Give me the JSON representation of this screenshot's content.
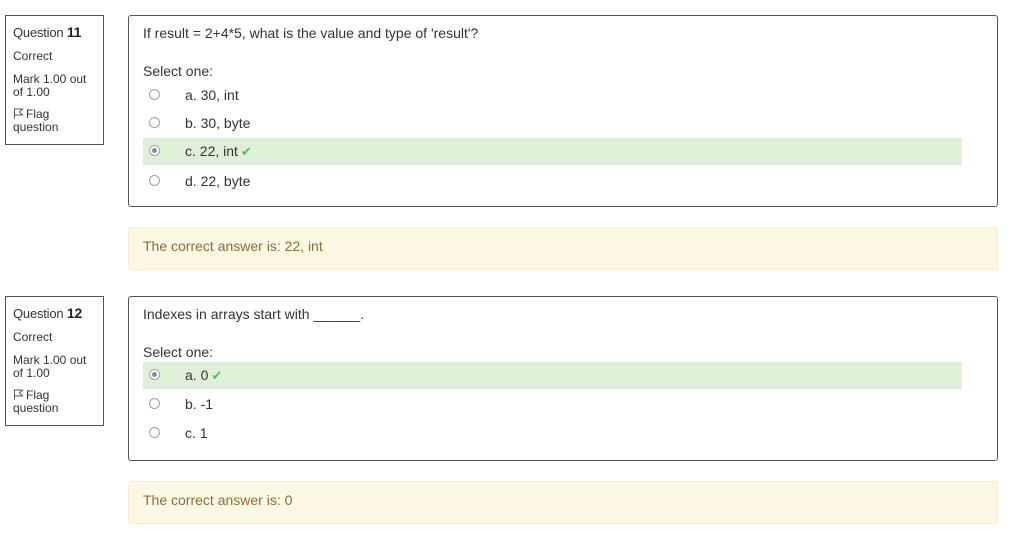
{
  "questions": [
    {
      "info": {
        "question_prefix": "Question",
        "number": "11",
        "state": "Correct",
        "mark": "Mark 1.00 out of 1.00",
        "flag_label": "Flag question"
      },
      "text": "If result = 2+4*5, what is the value and type of 'result'?",
      "prompt": "Select one:",
      "options": [
        {
          "label": "a. 30, int",
          "selected": false,
          "correct": false
        },
        {
          "label": "b. 30, byte",
          "selected": false,
          "correct": false
        },
        {
          "label": "c. 22, int",
          "selected": true,
          "correct": true
        },
        {
          "label": "d. 22, byte",
          "selected": false,
          "correct": false
        }
      ],
      "feedback": "The correct answer is: 22, int"
    },
    {
      "info": {
        "question_prefix": "Question",
        "number": "12",
        "state": "Correct",
        "mark": "Mark 1.00 out of 1.00",
        "flag_label": "Flag question"
      },
      "text": "Indexes in arrays start with ______.",
      "prompt": "Select one:",
      "options": [
        {
          "label": "a. 0",
          "selected": true,
          "correct": true
        },
        {
          "label": "b. -1",
          "selected": false,
          "correct": false
        },
        {
          "label": "c. 1",
          "selected": false,
          "correct": false
        }
      ],
      "feedback": "The correct answer is: 0"
    }
  ],
  "icons": {
    "flag": "flag-icon",
    "correct": "check-icon"
  },
  "colors": {
    "correct_bg": "#dff0d8",
    "correct_check": "#5cb85c",
    "feedback_bg": "#fcf8e3",
    "feedback_text": "#8a6d3b"
  }
}
